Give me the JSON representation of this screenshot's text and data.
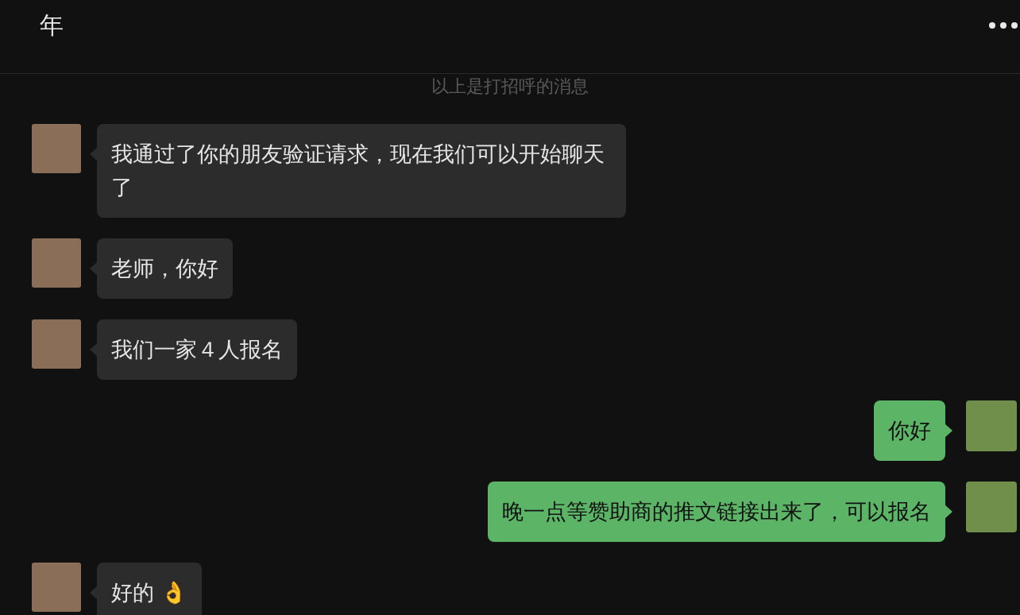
{
  "header": {
    "title": "年"
  },
  "system_notice": "以上是打招呼的消息",
  "messages": [
    {
      "kind": "received",
      "text": "我通过了你的朋友验证请求，现在我们可以开始聊天了"
    },
    {
      "kind": "received",
      "text": "老师，你好"
    },
    {
      "kind": "received",
      "text": "我们一家４人报名"
    },
    {
      "kind": "sent",
      "text": "你好"
    },
    {
      "kind": "sent",
      "text": "晚一点等赞助商的推文链接出来了，可以报名"
    },
    {
      "kind": "received",
      "text": "好的 👌"
    }
  ]
}
